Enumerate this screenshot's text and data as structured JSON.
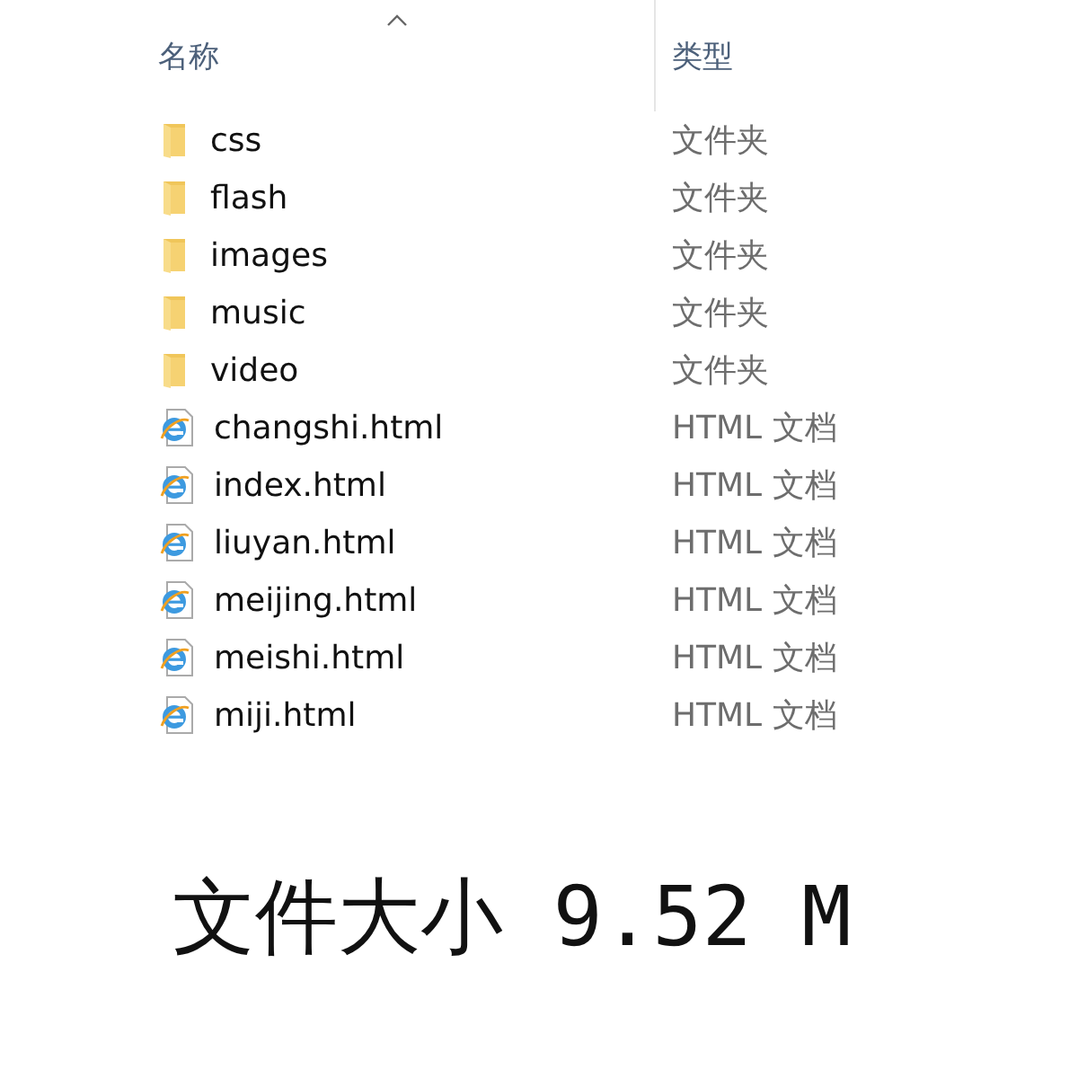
{
  "columns": [
    {
      "label": "名称",
      "sorted": true
    },
    {
      "label": "类型",
      "sorted": false
    }
  ],
  "files": [
    {
      "kind": "folder",
      "name": "css",
      "type": "文件夹"
    },
    {
      "kind": "folder",
      "name": "flash",
      "type": "文件夹"
    },
    {
      "kind": "folder",
      "name": "images",
      "type": "文件夹"
    },
    {
      "kind": "folder",
      "name": "music",
      "type": "文件夹"
    },
    {
      "kind": "folder",
      "name": "video",
      "type": "文件夹"
    },
    {
      "kind": "html",
      "name": "changshi.html",
      "type": "HTML 文档"
    },
    {
      "kind": "html",
      "name": "index.html",
      "type": "HTML 文档"
    },
    {
      "kind": "html",
      "name": "liuyan.html",
      "type": "HTML 文档"
    },
    {
      "kind": "html",
      "name": "meijing.html",
      "type": "HTML 文档"
    },
    {
      "kind": "html",
      "name": "meishi.html",
      "type": "HTML 文档"
    },
    {
      "kind": "html",
      "name": "miji.html",
      "type": "HTML 文档"
    }
  ],
  "caption": "文件大小 9.52 M"
}
